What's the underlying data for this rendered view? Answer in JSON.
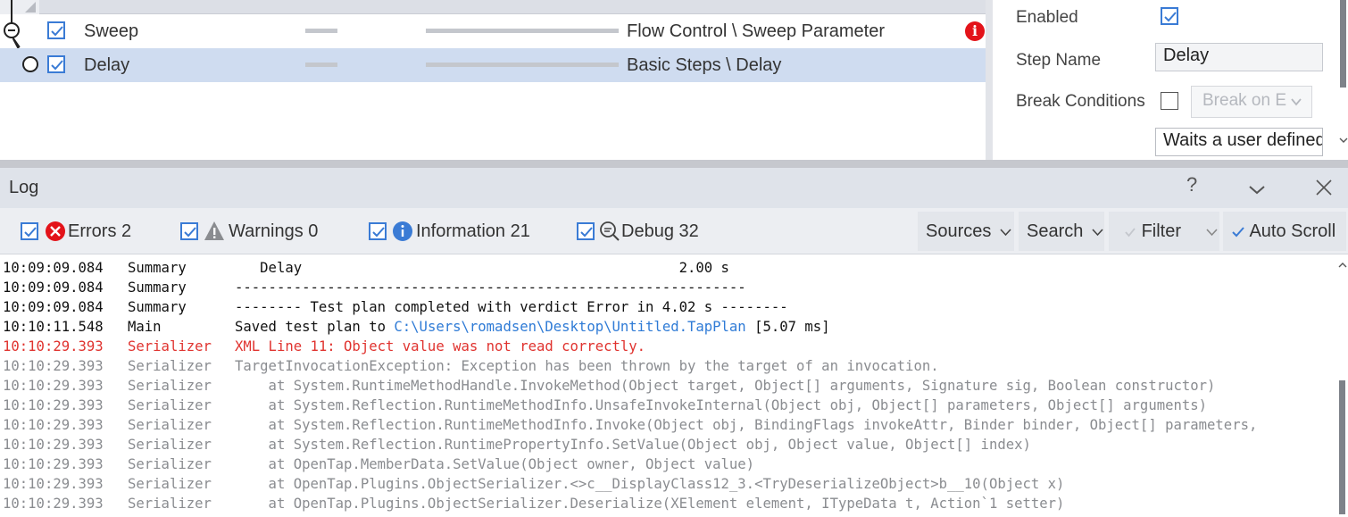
{
  "test_plan": {
    "rows": [
      {
        "name": "Sweep",
        "type": "Flow Control \\ Sweep Parameter",
        "enabled": true,
        "has_error": true,
        "selected": false
      },
      {
        "name": "Delay",
        "type": "Basic Steps \\ Delay",
        "enabled": true,
        "has_error": false,
        "selected": true
      }
    ],
    "error_glyph": "i"
  },
  "properties": {
    "enabled_label": "Enabled",
    "step_name_label": "Step Name",
    "step_name_value": "Delay",
    "break_conditions_label": "Break Conditions",
    "break_select_value": "Break on E",
    "description_value": "Waits a user defined"
  },
  "log": {
    "title": "Log",
    "help_glyph": "?",
    "filters": {
      "errors_label": "Errors 2",
      "warnings_label": "Warnings 0",
      "information_label": "Information 21",
      "debug_label": "Debug 32"
    },
    "buttons": {
      "sources_label": "Sources",
      "search_label": "Search",
      "filter_label": "Filter",
      "autoscroll_label": "Auto Scroll"
    },
    "entries": [
      {
        "time": "10:09:09.084",
        "source": "Summary",
        "level": "info",
        "message": "   Delay                                             2.00 s"
      },
      {
        "time": "10:09:09.084",
        "source": "Summary",
        "level": "info",
        "message": "-------------------------------------------------------------"
      },
      {
        "time": "10:09:09.084",
        "source": "Summary",
        "level": "info",
        "message": "-------- Test plan completed with verdict Error in 4.02 s --------"
      },
      {
        "time": "10:10:11.548",
        "source": "Main",
        "level": "info",
        "message": "Saved test plan to ",
        "link": "C:\\Users\\romadsen\\Desktop\\Untitled.TapPlan",
        "suffix": " [5.07 ms]"
      },
      {
        "time": "10:10:29.393",
        "source": "Serializer",
        "level": "error",
        "message": "XML Line 11: Object value was not read correctly."
      },
      {
        "time": "10:10:29.393",
        "source": "Serializer",
        "level": "debug",
        "message": "TargetInvocationException: Exception has been thrown by the target of an invocation."
      },
      {
        "time": "10:10:29.393",
        "source": "Serializer",
        "level": "debug",
        "message": "    at System.RuntimeMethodHandle.InvokeMethod(Object target, Object[] arguments, Signature sig, Boolean constructor)"
      },
      {
        "time": "10:10:29.393",
        "source": "Serializer",
        "level": "debug",
        "message": "    at System.Reflection.RuntimeMethodInfo.UnsafeInvokeInternal(Object obj, Object[] parameters, Object[] arguments)"
      },
      {
        "time": "10:10:29.393",
        "source": "Serializer",
        "level": "debug",
        "message": "    at System.Reflection.RuntimeMethodInfo.Invoke(Object obj, BindingFlags invokeAttr, Binder binder, Object[] parameters,"
      },
      {
        "time": "10:10:29.393",
        "source": "Serializer",
        "level": "debug",
        "message": "    at System.Reflection.RuntimePropertyInfo.SetValue(Object obj, Object value, Object[] index)"
      },
      {
        "time": "10:10:29.393",
        "source": "Serializer",
        "level": "debug",
        "message": "    at OpenTap.MemberData.SetValue(Object owner, Object value)"
      },
      {
        "time": "10:10:29.393",
        "source": "Serializer",
        "level": "debug",
        "message": "    at OpenTap.Plugins.ObjectSerializer.<>c__DisplayClass12_3.<TryDeserializeObject>b__10(Object x)"
      },
      {
        "time": "10:10:29.393",
        "source": "Serializer",
        "level": "debug",
        "message": "    at OpenTap.Plugins.ObjectSerializer.Deserialize(XElement element, ITypeData t, Action`1 setter)"
      }
    ]
  },
  "colors": {
    "accent": "#3a7bd5",
    "error": "#e0332f",
    "selection": "#cfdcf0",
    "link": "#2f7bd6"
  },
  "icons": {
    "error": "error-circle-icon",
    "warning": "warning-triangle-icon",
    "information": "info-circle-icon",
    "debug": "debug-magnifier-icon"
  }
}
